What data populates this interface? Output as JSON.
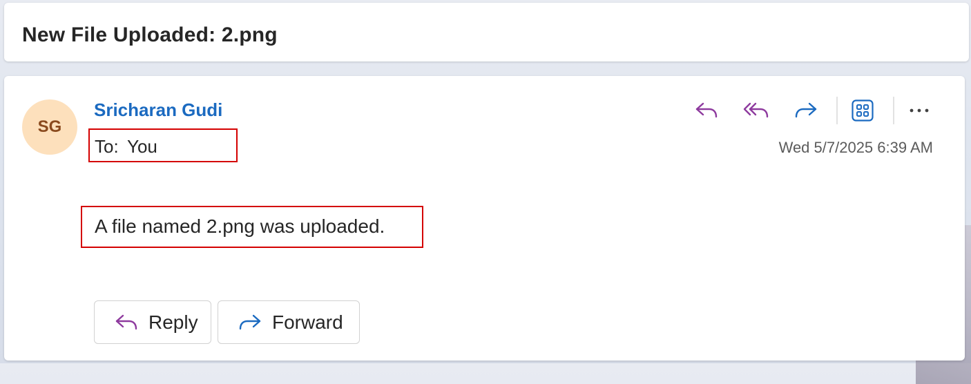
{
  "email": {
    "subject": "New File Uploaded: 2.png",
    "sender": {
      "initials": "SG",
      "name": "Sricharan Gudi",
      "avatar_color": "#fde0bc",
      "avatar_text_color": "#8a4a1e"
    },
    "to_label": "To:",
    "to_value": "You",
    "timestamp": "Wed 5/7/2025 6:39 AM",
    "body": "A file named 2.png was uploaded."
  },
  "toolbar": {
    "icons": [
      "reply-icon",
      "reply-all-icon",
      "forward-icon",
      "apps-icon",
      "more-icon"
    ]
  },
  "quick_actions": {
    "reply_label": "Reply",
    "forward_label": "Forward"
  },
  "colors": {
    "accent_purple": "#8e3a9e",
    "accent_blue": "#1b6ac0",
    "highlight_red": "#d40000"
  }
}
